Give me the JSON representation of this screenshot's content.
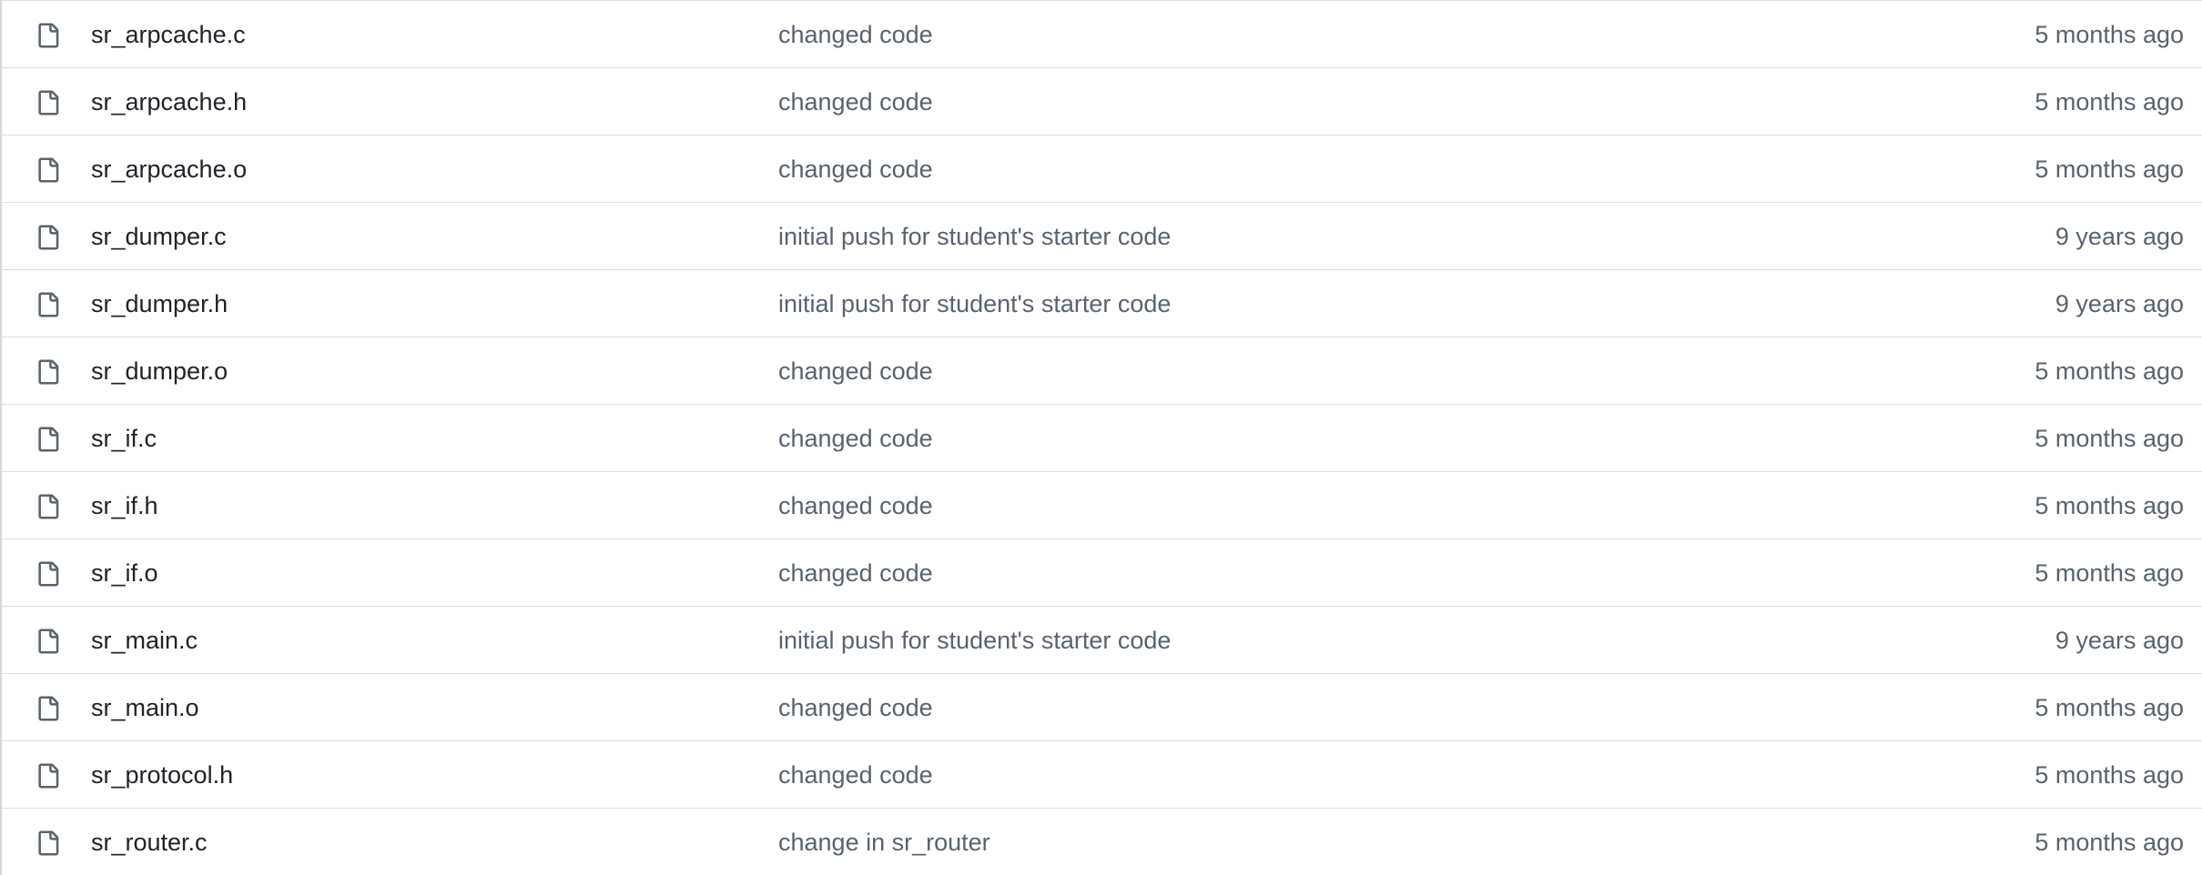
{
  "files": [
    {
      "name": "sr_arpcache.c",
      "icon": "file-icon",
      "commit_message": "changed code",
      "age": "5 months ago"
    },
    {
      "name": "sr_arpcache.h",
      "icon": "file-icon",
      "commit_message": "changed code",
      "age": "5 months ago"
    },
    {
      "name": "sr_arpcache.o",
      "icon": "file-icon",
      "commit_message": "changed code",
      "age": "5 months ago"
    },
    {
      "name": "sr_dumper.c",
      "icon": "file-icon",
      "commit_message": "initial push for student's starter code",
      "age": "9 years ago"
    },
    {
      "name": "sr_dumper.h",
      "icon": "file-icon",
      "commit_message": "initial push for student's starter code",
      "age": "9 years ago"
    },
    {
      "name": "sr_dumper.o",
      "icon": "file-icon",
      "commit_message": "changed code",
      "age": "5 months ago"
    },
    {
      "name": "sr_if.c",
      "icon": "file-icon",
      "commit_message": "changed code",
      "age": "5 months ago"
    },
    {
      "name": "sr_if.h",
      "icon": "file-icon",
      "commit_message": "changed code",
      "age": "5 months ago"
    },
    {
      "name": "sr_if.o",
      "icon": "file-icon",
      "commit_message": "changed code",
      "age": "5 months ago"
    },
    {
      "name": "sr_main.c",
      "icon": "file-icon",
      "commit_message": "initial push for student's starter code",
      "age": "9 years ago"
    },
    {
      "name": "sr_main.o",
      "icon": "file-icon",
      "commit_message": "changed code",
      "age": "5 months ago"
    },
    {
      "name": "sr_protocol.h",
      "icon": "file-icon",
      "commit_message": "changed code",
      "age": "5 months ago"
    },
    {
      "name": "sr_router.c",
      "icon": "file-icon",
      "commit_message": "change in sr_router",
      "age": "5 months ago"
    }
  ],
  "colors": {
    "icon": "#59636e",
    "file_name": "#1f2328",
    "muted_text": "#59636e",
    "row_border": "#d8dee4"
  }
}
